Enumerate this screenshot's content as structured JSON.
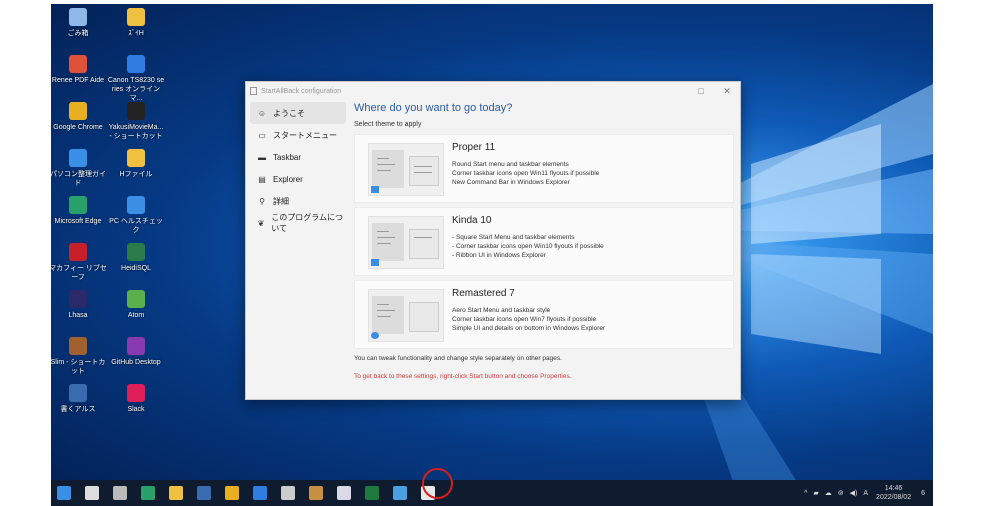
{
  "desktop_icons": [
    {
      "label": "ごみ箱",
      "color": "#8fb7e8"
    },
    {
      "label": "ｽﾞｲH",
      "color": "#f0c040"
    },
    {
      "label": "Renee PDF Aide",
      "color": "#e0503a"
    },
    {
      "label": "Canon TS8230 series オンラインマ...",
      "color": "#2f7de0"
    },
    {
      "label": "Google Chrome",
      "color": "#e8b020"
    },
    {
      "label": "YakusiMovieMa... - ショートカット",
      "color": "#222222"
    },
    {
      "label": "パソコン整理ガイド",
      "color": "#3a8ee6"
    },
    {
      "label": "Hファイル",
      "color": "#f0c040"
    },
    {
      "label": "Microsoft Edge",
      "color": "#2aa06a"
    },
    {
      "label": "PC ヘルスチェック",
      "color": "#3a8ee6"
    },
    {
      "label": "マカフィー リブセーフ",
      "color": "#c8202a"
    },
    {
      "label": "HeidiSQL",
      "color": "#2a7a4a"
    },
    {
      "label": "Lhasa",
      "color": "#2a2a6a"
    },
    {
      "label": "Atom",
      "color": "#5ab04a"
    },
    {
      "label": "Slim - ショートカット",
      "color": "#a06030"
    },
    {
      "label": "GitHub Desktop",
      "color": "#8a3ab0"
    },
    {
      "label": "書くアルス",
      "color": "#3a6ab0"
    },
    {
      "label": "Slack",
      "color": "#e01e5a"
    }
  ],
  "window": {
    "title": "StartAllBack configuration",
    "minimize": "□",
    "close": "✕",
    "nav": [
      {
        "label": "ようこそ",
        "icon": "☺"
      },
      {
        "label": "スタートメニュー",
        "icon": "▭"
      },
      {
        "label": "Taskbar",
        "icon": "▬"
      },
      {
        "label": "Explorer",
        "icon": "▤"
      },
      {
        "label": "詳細",
        "icon": "⚲"
      },
      {
        "label": "このプログラムについて",
        "icon": "❦"
      }
    ],
    "heading": "Where do you want to go today?",
    "subhead": "Select theme to apply",
    "themes": [
      {
        "name": "Proper 11",
        "desc": "Round Start menu and taskbar elements\nCorner taskbar icons open Win11 flyouts if possible\nNew Command Bar in Windows Explorer"
      },
      {
        "name": "Kinda 10",
        "desc": "- Square Start Menu and taskbar elements\n- Corner taskbar icons open Win10 flyouts if possible\n- Ribbon UI in Windows Explorer"
      },
      {
        "name": "Remastered 7",
        "desc": "Aero Start Menu and taskbar style\nCorner taskbar icons open Win7 flyouts if possible\nSimple UI and details on bottom in Windows Explorer"
      }
    ],
    "note": "You can tweak functionality and change style separately on other pages.",
    "note_red": "To get back to these settings, right-click Start button and choose Properties."
  },
  "taskbar": {
    "icons": [
      "#3a8ee6",
      "#dddddd",
      "#bbbbbb",
      "#2aa06a",
      "#f0c040",
      "#3a6ab0",
      "#e8b020",
      "#2f7de0",
      "#cccccc",
      "#c89040",
      "#d8d8e8",
      "#1f7a40",
      "#4aa0e0",
      "#e8e8e8"
    ],
    "tray": [
      "^",
      "▰",
      "☁",
      "⊚",
      "◀)",
      "A"
    ],
    "time": "14:46",
    "date": "2022/08/02",
    "notification": "6"
  }
}
